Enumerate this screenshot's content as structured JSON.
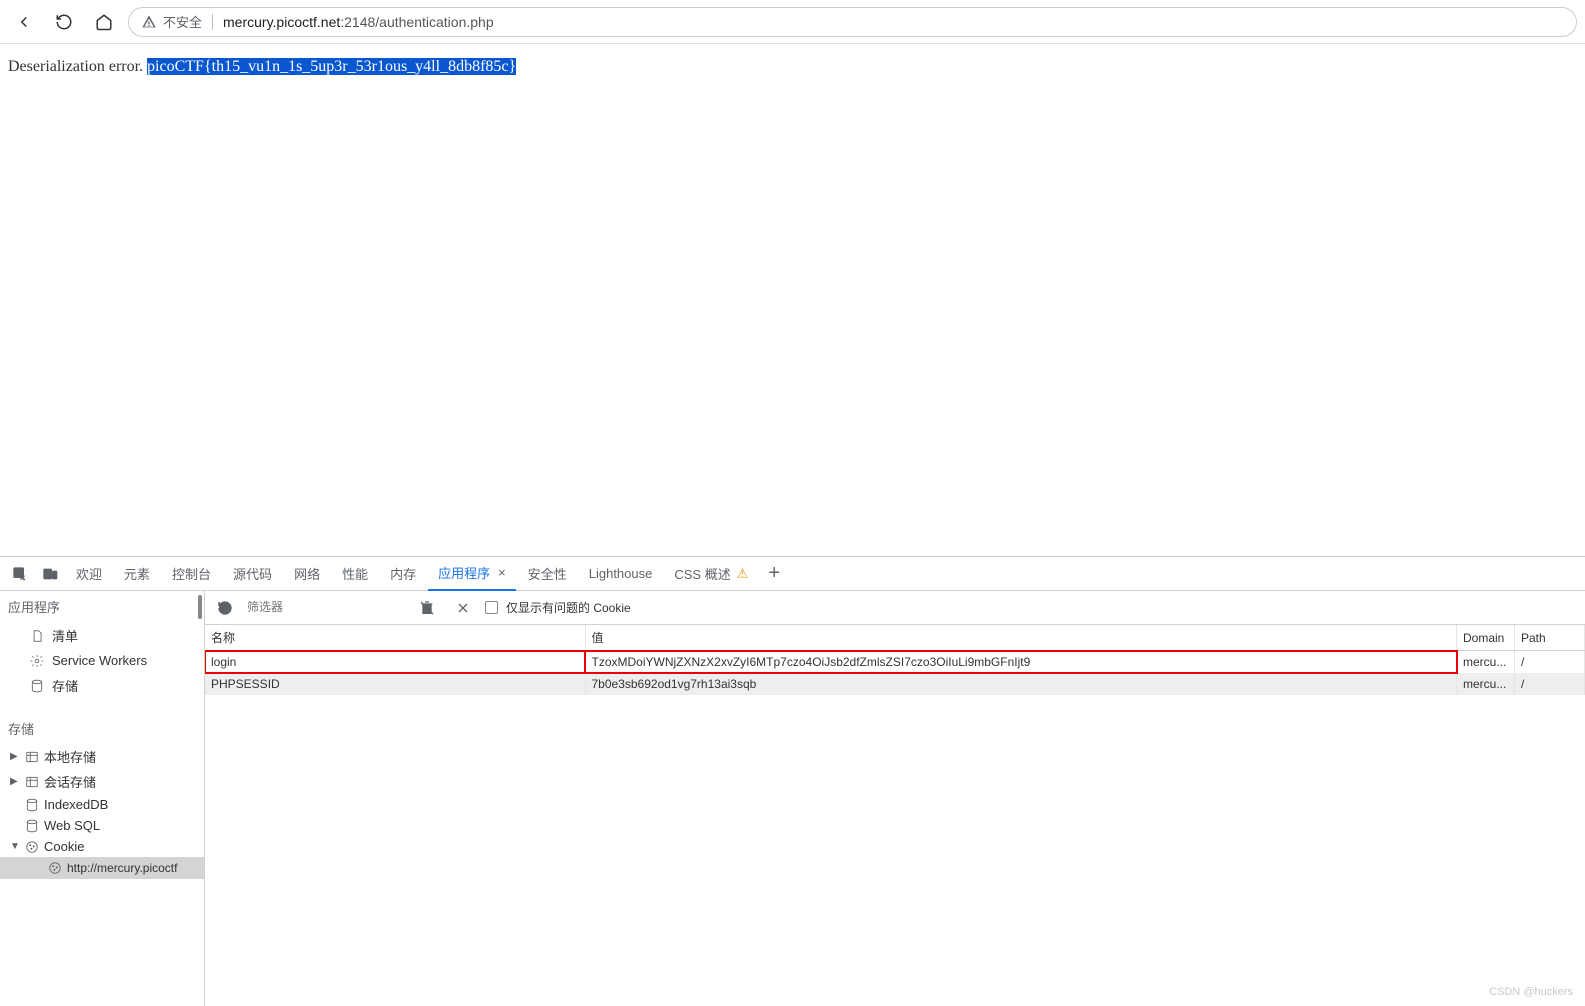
{
  "browser": {
    "insecure_label": "不安全",
    "url_host": "mercury.picoctf.net",
    "url_path": ":2148/authentication.php"
  },
  "page": {
    "prefix_text": "Deserialization error. ",
    "flag_text": "picoCTF{th15_vu1n_1s_5up3r_53r1ous_y4ll_8db8f85c}"
  },
  "devtools": {
    "tabs": {
      "welcome": "欢迎",
      "elements": "元素",
      "console": "控制台",
      "sources": "源代码",
      "network": "网络",
      "performance": "性能",
      "memory": "内存",
      "application": "应用程序",
      "security": "安全性",
      "lighthouse": "Lighthouse",
      "css_overview": "CSS 概述"
    },
    "toolbar": {
      "filter_placeholder": "筛选器",
      "only_issues_label": "仅显示有问题的 Cookie"
    },
    "sidebar": {
      "app_section": "应用程序",
      "manifest": "清单",
      "service_workers": "Service Workers",
      "storage": "存储",
      "storage_section": "存储",
      "local_storage": "本地存储",
      "session_storage": "会话存储",
      "indexeddb": "IndexedDB",
      "websql": "Web SQL",
      "cookie": "Cookie",
      "cookie_origin": "http://mercury.picoctf"
    },
    "table": {
      "headers": {
        "name": "名称",
        "value": "值",
        "domain": "Domain",
        "path": "Path"
      },
      "rows": [
        {
          "name": "login",
          "value": "TzoxMDoiYWNjZXNzX2xvZyI6MTp7czo4OiJsb2dfZmlsZSI7czo3OiIuLi9mbGFnIjt9",
          "domain": "mercu...",
          "path": "/"
        },
        {
          "name": "PHPSESSID",
          "value": "7b0e3sb692od1vg7rh13ai3sqb",
          "domain": "mercu...",
          "path": "/"
        }
      ]
    }
  },
  "watermark": "CSDN @huckers"
}
